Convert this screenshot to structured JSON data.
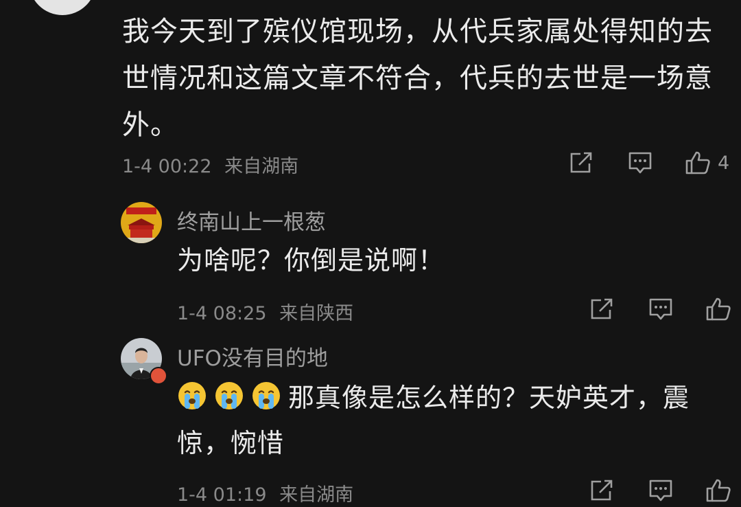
{
  "comment": {
    "text": "我今天到了殡仪馆现场，从代兵家属处得知的去世情况和这篇文章不符合，代兵的去世是一场意外。",
    "time": "1-4 00:22",
    "location": "来自湖南",
    "like_count": "4"
  },
  "replies": [
    {
      "username": "终南山上一根葱",
      "text": "为啥呢？你倒是说啊！",
      "time": "1-4 08:25",
      "location": "来自陕西"
    },
    {
      "username": "UFO没有目的地",
      "emoji": [
        "crying-face",
        "crying-face",
        "crying-face"
      ],
      "text": "那真像是怎么样的？天妒英才，震惊，惋惜",
      "time": "1-4 01:19",
      "location": "来自湖南"
    }
  ],
  "icons": [
    "share-icon",
    "reply-icon",
    "like-icon"
  ],
  "colors": {
    "background": "#141414",
    "primary_text": "#ebebeb",
    "secondary_text": "#8a8a8a",
    "icon": "#a0a0a0"
  }
}
